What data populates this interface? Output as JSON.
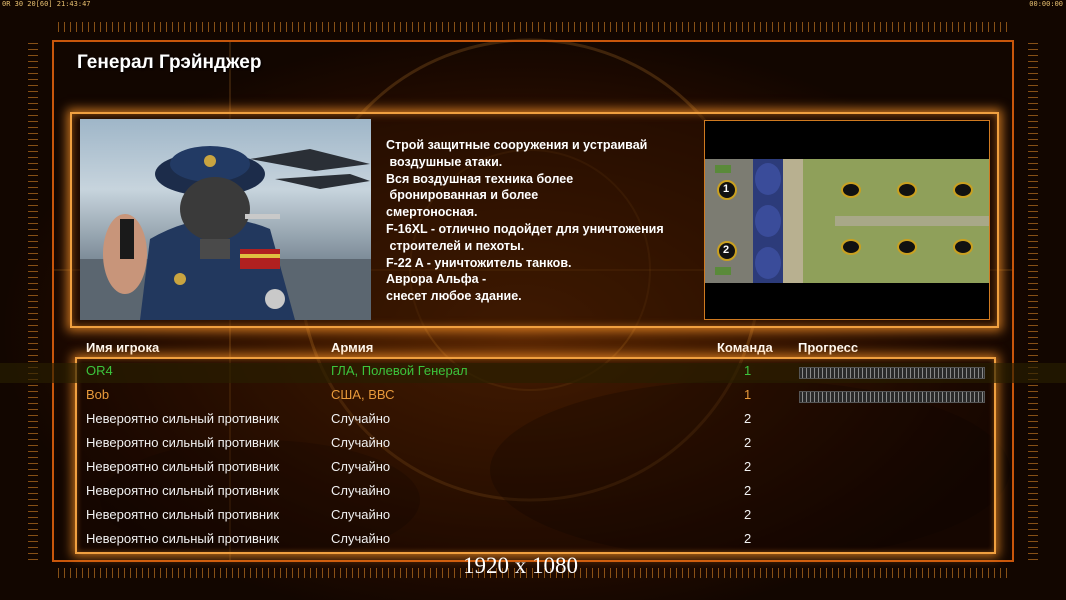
{
  "status_bar": {
    "left_text": "0R 30 20[60] 21:43:47",
    "right_text": "00:00:00"
  },
  "title": "Генерал Грэйнджер",
  "briefing_lines": [
    "Строй защитные сооружения и устраивай",
    " воздушные атаки.",
    "Вся воздушная техника более",
    " бронированная и более",
    "смертоносная.",
    "F-16XL - отлично подойдет для уничтожения",
    " строителей и пехоты.",
    "F-22 A - уничтожитель танков.",
    "Аврора Альфа -",
    "снесет любое здание."
  ],
  "minimap": {
    "start_positions": [
      "1",
      "2"
    ]
  },
  "player_table": {
    "headers": {
      "name": "Имя игрока",
      "army": "Армия",
      "team": "Команда",
      "progress": "Прогресс"
    },
    "rows": [
      {
        "name": "OR4",
        "army": "ГЛА, Полевой Генерал",
        "team": "1",
        "color": "#3cc43c",
        "has_progress": true
      },
      {
        "name": "Bob",
        "army": "США, ВВС",
        "team": "1",
        "color": "#e89a3a",
        "has_progress": true
      },
      {
        "name": "Невероятно сильный противник",
        "army": "Случайно",
        "team": "2",
        "color": "#f2f2f2",
        "has_progress": false
      },
      {
        "name": "Невероятно сильный противник",
        "army": "Случайно",
        "team": "2",
        "color": "#f2f2f2",
        "has_progress": false
      },
      {
        "name": "Невероятно сильный противник",
        "army": "Случайно",
        "team": "2",
        "color": "#f2f2f2",
        "has_progress": false
      },
      {
        "name": "Невероятно сильный противник",
        "army": "Случайно",
        "team": "2",
        "color": "#f2f2f2",
        "has_progress": false
      },
      {
        "name": "Невероятно сильный противник",
        "army": "Случайно",
        "team": "2",
        "color": "#f2f2f2",
        "has_progress": false
      },
      {
        "name": "Невероятно сильный противник",
        "army": "Случайно",
        "team": "2",
        "color": "#f2f2f2",
        "has_progress": false
      }
    ]
  },
  "resolution_label": "1920 x 1080",
  "colors": {
    "accent": "#f0a040",
    "frame": "#c8560b"
  }
}
